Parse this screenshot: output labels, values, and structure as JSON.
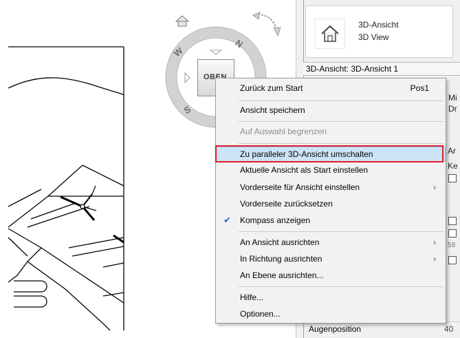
{
  "panel": {
    "type_name": "3D-Ansicht",
    "type_name_en": "3D View",
    "instance": "3D-Ansicht: 3D-Ansicht 1",
    "fragments": [
      "Mi",
      "Dr",
      "Ar",
      "Ke",
      "59"
    ],
    "eye_position_label": "Augenposition",
    "eye_position_value": "40"
  },
  "viewcube": {
    "face_label": "OBEN",
    "compass": [
      "N",
      "W",
      "S"
    ]
  },
  "menu": {
    "items": [
      {
        "label": "Zurück zum Start",
        "shortcut": "Pos1"
      },
      {
        "label": "Ansicht speichern"
      },
      {
        "label": "Auf Auswahl begrenzen",
        "disabled": true
      },
      {
        "label": "Zu paralleler 3D-Ansicht umschalten",
        "highlighted": true
      },
      {
        "label": "Aktuelle Ansicht als Start einstellen"
      },
      {
        "label": "Vorderseite für Ansicht einstellen",
        "submenu": "›"
      },
      {
        "label": "Vorderseite zurücksetzen"
      },
      {
        "label": "Kompass anzeigen",
        "checked": "✔"
      },
      {
        "label": "An Ansicht ausrichten",
        "submenu": "›"
      },
      {
        "label": "In Richtung ausrichten",
        "submenu": "›"
      },
      {
        "label": "An Ebene ausrichten..."
      },
      {
        "label": "Hilfe..."
      },
      {
        "label": "Optionen..."
      }
    ]
  },
  "colors": {
    "highlight": "#cce4f7",
    "annotation_outline": "#e01b24",
    "check": "#1e66c8"
  }
}
